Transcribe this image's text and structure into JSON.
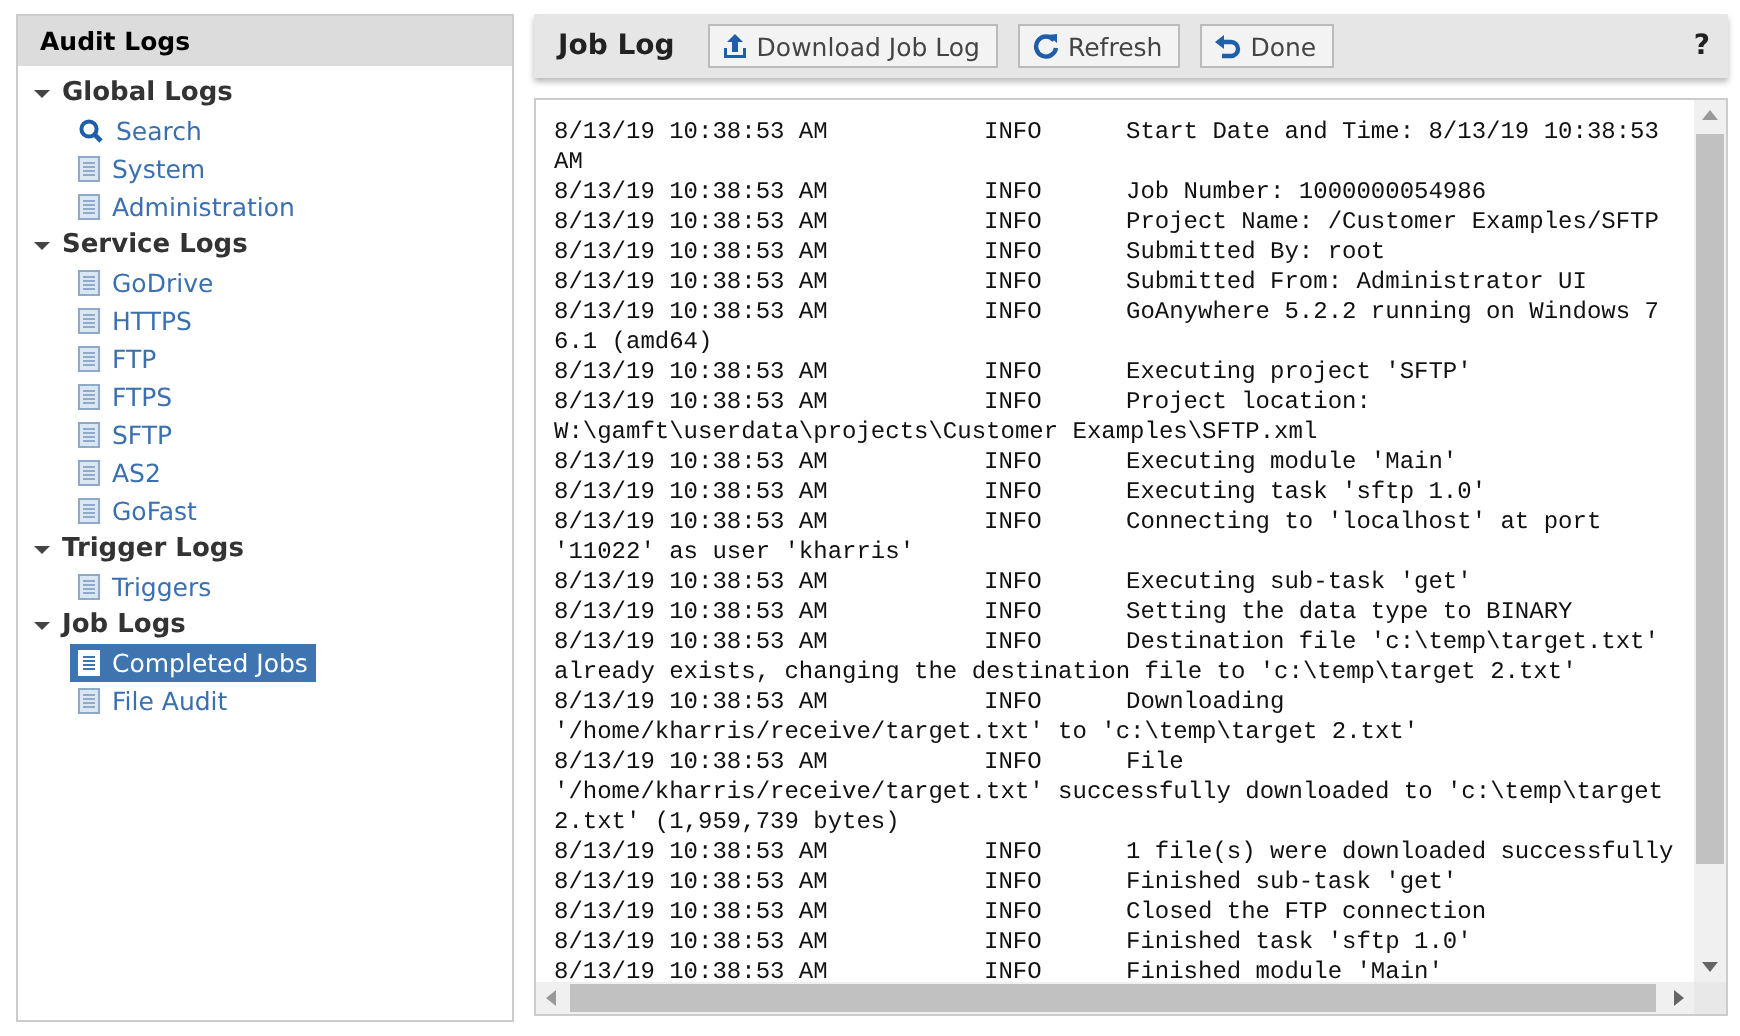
{
  "sidebar": {
    "title": "Audit Logs",
    "groups": [
      {
        "label": "Global Logs",
        "expanded": true,
        "children": [
          {
            "label": "Search",
            "kind": "search",
            "selected": false
          },
          {
            "label": "System",
            "kind": "log",
            "selected": false
          },
          {
            "label": "Administration",
            "kind": "log",
            "selected": false
          }
        ]
      },
      {
        "label": "Service Logs",
        "expanded": true,
        "children": [
          {
            "label": "GoDrive",
            "kind": "log",
            "selected": false
          },
          {
            "label": "HTTPS",
            "kind": "log",
            "selected": false
          },
          {
            "label": "FTP",
            "kind": "log",
            "selected": false
          },
          {
            "label": "FTPS",
            "kind": "log",
            "selected": false
          },
          {
            "label": "SFTP",
            "kind": "log",
            "selected": false
          },
          {
            "label": "AS2",
            "kind": "log",
            "selected": false
          },
          {
            "label": "GoFast",
            "kind": "log",
            "selected": false
          }
        ]
      },
      {
        "label": "Trigger Logs",
        "expanded": true,
        "children": [
          {
            "label": "Triggers",
            "kind": "log",
            "selected": false
          }
        ]
      },
      {
        "label": "Job Logs",
        "expanded": true,
        "children": [
          {
            "label": "Completed Jobs",
            "kind": "log",
            "selected": true
          },
          {
            "label": "File Audit",
            "kind": "log",
            "selected": false
          }
        ]
      }
    ]
  },
  "main": {
    "title": "Job Log",
    "buttons": [
      {
        "label": "Download Job Log",
        "kind": "download"
      },
      {
        "label": "Refresh",
        "kind": "refresh"
      },
      {
        "label": "Done",
        "kind": "done"
      }
    ],
    "help": "?",
    "log": [
      {
        "time": "8/13/19 10:38:53 AM",
        "level": "INFO",
        "message": "Start Date and Time: 8/13/19 10:38:53 AM"
      },
      {
        "time": "8/13/19 10:38:53 AM",
        "level": "INFO",
        "message": "Job Number: 1000000054986"
      },
      {
        "time": "8/13/19 10:38:53 AM",
        "level": "INFO",
        "message": "Project Name: /Customer Examples/SFTP"
      },
      {
        "time": "8/13/19 10:38:53 AM",
        "level": "INFO",
        "message": "Submitted By: root"
      },
      {
        "time": "8/13/19 10:38:53 AM",
        "level": "INFO",
        "message": "Submitted From: Administrator UI"
      },
      {
        "time": "8/13/19 10:38:53 AM",
        "level": "INFO",
        "message": "GoAnywhere 5.2.2 running on Windows 7 6.1 (amd64)"
      },
      {
        "time": "8/13/19 10:38:53 AM",
        "level": "INFO",
        "message": "Executing project 'SFTP'"
      },
      {
        "time": "8/13/19 10:38:53 AM",
        "level": "INFO",
        "message": "Project location: W:\\gamft\\userdata\\projects\\Customer Examples\\SFTP.xml"
      },
      {
        "time": "8/13/19 10:38:53 AM",
        "level": "INFO",
        "message": "Executing module 'Main'"
      },
      {
        "time": "8/13/19 10:38:53 AM",
        "level": "INFO",
        "message": "Executing task 'sftp 1.0'"
      },
      {
        "time": "8/13/19 10:38:53 AM",
        "level": "INFO",
        "message": "Connecting to 'localhost' at port '11022' as user 'kharris'"
      },
      {
        "time": "8/13/19 10:38:53 AM",
        "level": "INFO",
        "message": "Executing sub-task 'get'"
      },
      {
        "time": "8/13/19 10:38:53 AM",
        "level": "INFO",
        "message": "Setting the data type to BINARY"
      },
      {
        "time": "8/13/19 10:38:53 AM",
        "level": "INFO",
        "message": "Destination file 'c:\\temp\\target.txt' already exists, changing the destination file to 'c:\\temp\\target 2.txt'"
      },
      {
        "time": "8/13/19 10:38:53 AM",
        "level": "INFO",
        "message": "Downloading '/home/kharris/receive/target.txt' to 'c:\\temp\\target 2.txt'"
      },
      {
        "time": "8/13/19 10:38:53 AM",
        "level": "INFO",
        "message": "File '/home/kharris/receive/target.txt' successfully downloaded to 'c:\\temp\\target 2.txt' (1,959,739 bytes)"
      },
      {
        "time": "8/13/19 10:38:53 AM",
        "level": "INFO",
        "message": "1 file(s) were downloaded successfully"
      },
      {
        "time": "8/13/19 10:38:53 AM",
        "level": "INFO",
        "message": "Finished sub-task 'get'"
      },
      {
        "time": "8/13/19 10:38:53 AM",
        "level": "INFO",
        "message": "Closed the FTP connection"
      },
      {
        "time": "8/13/19 10:38:53 AM",
        "level": "INFO",
        "message": "Finished task 'sftp 1.0'"
      },
      {
        "time": "8/13/19 10:38:53 AM",
        "level": "INFO",
        "message": "Finished module 'Main'"
      }
    ]
  }
}
